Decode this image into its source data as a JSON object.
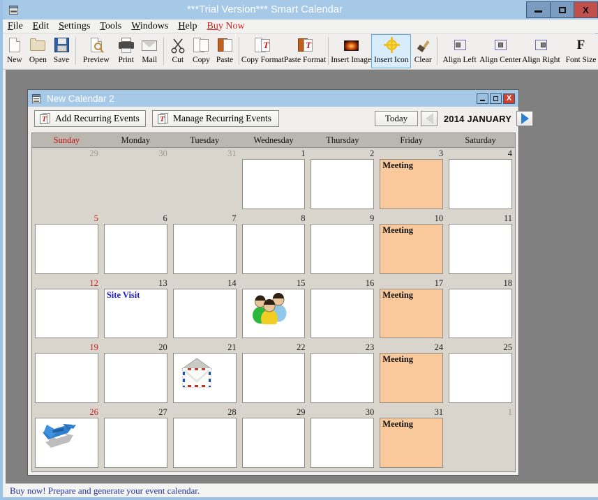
{
  "window": {
    "title": "***Trial Version*** Smart Calendar",
    "icon": "calendar-app-icon",
    "minimize_label": "Minimize",
    "maximize_label": "Maximize",
    "close_label": "X",
    "accent_titlebar": "#a6c9e8",
    "close_color": "#c0504d"
  },
  "menubar": {
    "items": [
      {
        "label": "File",
        "mnemonic": "F"
      },
      {
        "label": "Edit",
        "mnemonic": "E"
      },
      {
        "label": "Settings",
        "mnemonic": "S"
      },
      {
        "label": "Tools",
        "mnemonic": "T"
      },
      {
        "label": "Windows",
        "mnemonic": "W"
      },
      {
        "label": "Help",
        "mnemonic": "H"
      },
      {
        "label": "Buy Now",
        "mnemonic": "B",
        "color": "#d02020"
      }
    ]
  },
  "toolbar": {
    "items": [
      {
        "label": "New",
        "icon": "new-document-icon",
        "selected": false
      },
      {
        "label": "Open",
        "icon": "open-folder-icon",
        "selected": false
      },
      {
        "label": "Save",
        "icon": "floppy-disk-icon",
        "selected": false
      },
      {
        "label": "Preview",
        "icon": "print-preview-icon",
        "selected": false
      },
      {
        "label": "Print",
        "icon": "printer-icon",
        "selected": false
      },
      {
        "label": "Mail",
        "icon": "mail-envelope-icon",
        "selected": false
      },
      {
        "label": "Cut",
        "icon": "scissors-icon",
        "selected": false
      },
      {
        "label": "Copy",
        "icon": "copy-pages-icon",
        "selected": false
      },
      {
        "label": "Paste",
        "icon": "paste-clipboard-icon",
        "selected": false
      },
      {
        "label": "Copy Format",
        "icon": "copy-format-icon",
        "selected": false
      },
      {
        "label": "Paste Format",
        "icon": "paste-format-icon",
        "selected": false
      },
      {
        "label": "Insert Image",
        "icon": "insert-image-icon",
        "selected": false
      },
      {
        "label": "Insert Icon",
        "icon": "insert-icon-sun-icon",
        "selected": true
      },
      {
        "label": "Clear",
        "icon": "clear-brush-icon",
        "selected": false
      },
      {
        "label": "Align Left",
        "icon": "align-left-icon",
        "selected": false
      },
      {
        "label": "Align Center",
        "icon": "align-center-icon",
        "selected": false
      },
      {
        "label": "Align Right",
        "icon": "align-right-icon",
        "selected": false
      },
      {
        "label": "Font Size",
        "icon": "font-size-icon",
        "selected": false
      }
    ]
  },
  "child_window": {
    "title": "New Calendar 2",
    "icon": "calendar-document-icon",
    "minimize_label": "Minimize",
    "maximize_label": "Maximize",
    "close_label": "X",
    "buttons": {
      "add_recurring": "Add Recurring Events",
      "manage_recurring": "Manage Recurring Events",
      "today": "Today"
    },
    "nav": {
      "prev_label": "Previous Month",
      "next_label": "Next Month",
      "month_label": "2014 JANUARY"
    }
  },
  "calendar": {
    "day_headers": [
      "Sunday",
      "Monday",
      "Tuesday",
      "Wednesday",
      "Thursday",
      "Friday",
      "Saturday"
    ],
    "sunday_color": "#cc1010",
    "event_bg": "#fac99b",
    "weeks": [
      [
        {
          "num": "29",
          "out": true,
          "box": false,
          "event": "",
          "icon": ""
        },
        {
          "num": "30",
          "out": true,
          "box": false,
          "event": "",
          "icon": ""
        },
        {
          "num": "31",
          "out": true,
          "box": false,
          "event": "",
          "icon": ""
        },
        {
          "num": "1",
          "out": false,
          "box": true,
          "event": "",
          "icon": ""
        },
        {
          "num": "2",
          "out": false,
          "box": true,
          "event": "",
          "icon": ""
        },
        {
          "num": "3",
          "out": false,
          "box": true,
          "event": "Meeting",
          "highlight": true,
          "icon": ""
        },
        {
          "num": "4",
          "out": false,
          "box": true,
          "event": "",
          "icon": ""
        }
      ],
      [
        {
          "num": "5",
          "out": false,
          "sunday": true,
          "box": true,
          "event": "",
          "icon": ""
        },
        {
          "num": "6",
          "out": false,
          "box": true,
          "event": "",
          "icon": ""
        },
        {
          "num": "7",
          "out": false,
          "box": true,
          "event": "",
          "icon": ""
        },
        {
          "num": "8",
          "out": false,
          "box": true,
          "event": "",
          "icon": ""
        },
        {
          "num": "9",
          "out": false,
          "box": true,
          "event": "",
          "icon": ""
        },
        {
          "num": "10",
          "out": false,
          "box": true,
          "event": "Meeting",
          "highlight": true,
          "icon": ""
        },
        {
          "num": "11",
          "out": false,
          "box": true,
          "event": "",
          "icon": ""
        }
      ],
      [
        {
          "num": "12",
          "out": false,
          "sunday": true,
          "box": true,
          "event": "",
          "icon": ""
        },
        {
          "num": "13",
          "out": false,
          "box": true,
          "event": "Site Visit",
          "event_color": "blue",
          "icon": ""
        },
        {
          "num": "14",
          "out": false,
          "box": true,
          "event": "",
          "icon": ""
        },
        {
          "num": "15",
          "out": false,
          "box": true,
          "event": "",
          "icon": "people-group-icon"
        },
        {
          "num": "16",
          "out": false,
          "box": true,
          "event": "",
          "icon": ""
        },
        {
          "num": "17",
          "out": false,
          "box": true,
          "event": "Meeting",
          "highlight": true,
          "icon": ""
        },
        {
          "num": "18",
          "out": false,
          "box": true,
          "event": "",
          "icon": ""
        }
      ],
      [
        {
          "num": "19",
          "out": false,
          "sunday": true,
          "box": true,
          "event": "",
          "icon": ""
        },
        {
          "num": "20",
          "out": false,
          "box": true,
          "event": "",
          "icon": ""
        },
        {
          "num": "21",
          "out": false,
          "box": true,
          "event": "",
          "icon": "airmail-envelope-icon"
        },
        {
          "num": "22",
          "out": false,
          "box": true,
          "event": "",
          "icon": ""
        },
        {
          "num": "23",
          "out": false,
          "box": true,
          "event": "",
          "icon": ""
        },
        {
          "num": "24",
          "out": false,
          "box": true,
          "event": "Meeting",
          "highlight": true,
          "icon": ""
        },
        {
          "num": "25",
          "out": false,
          "box": true,
          "event": "",
          "icon": ""
        }
      ],
      [
        {
          "num": "26",
          "out": false,
          "sunday": true,
          "box": true,
          "event": "",
          "icon": "airplane-icon"
        },
        {
          "num": "27",
          "out": false,
          "box": true,
          "event": "",
          "icon": ""
        },
        {
          "num": "28",
          "out": false,
          "box": true,
          "event": "",
          "icon": ""
        },
        {
          "num": "29",
          "out": false,
          "box": true,
          "event": "",
          "icon": ""
        },
        {
          "num": "30",
          "out": false,
          "box": true,
          "event": "",
          "icon": ""
        },
        {
          "num": "31",
          "out": false,
          "box": true,
          "event": "Meeting",
          "highlight": true,
          "icon": ""
        },
        {
          "num": "1",
          "out": true,
          "box": false,
          "event": "",
          "icon": ""
        }
      ]
    ]
  },
  "statusbar": {
    "text": "Buy now! Prepare and generate your event calendar."
  }
}
